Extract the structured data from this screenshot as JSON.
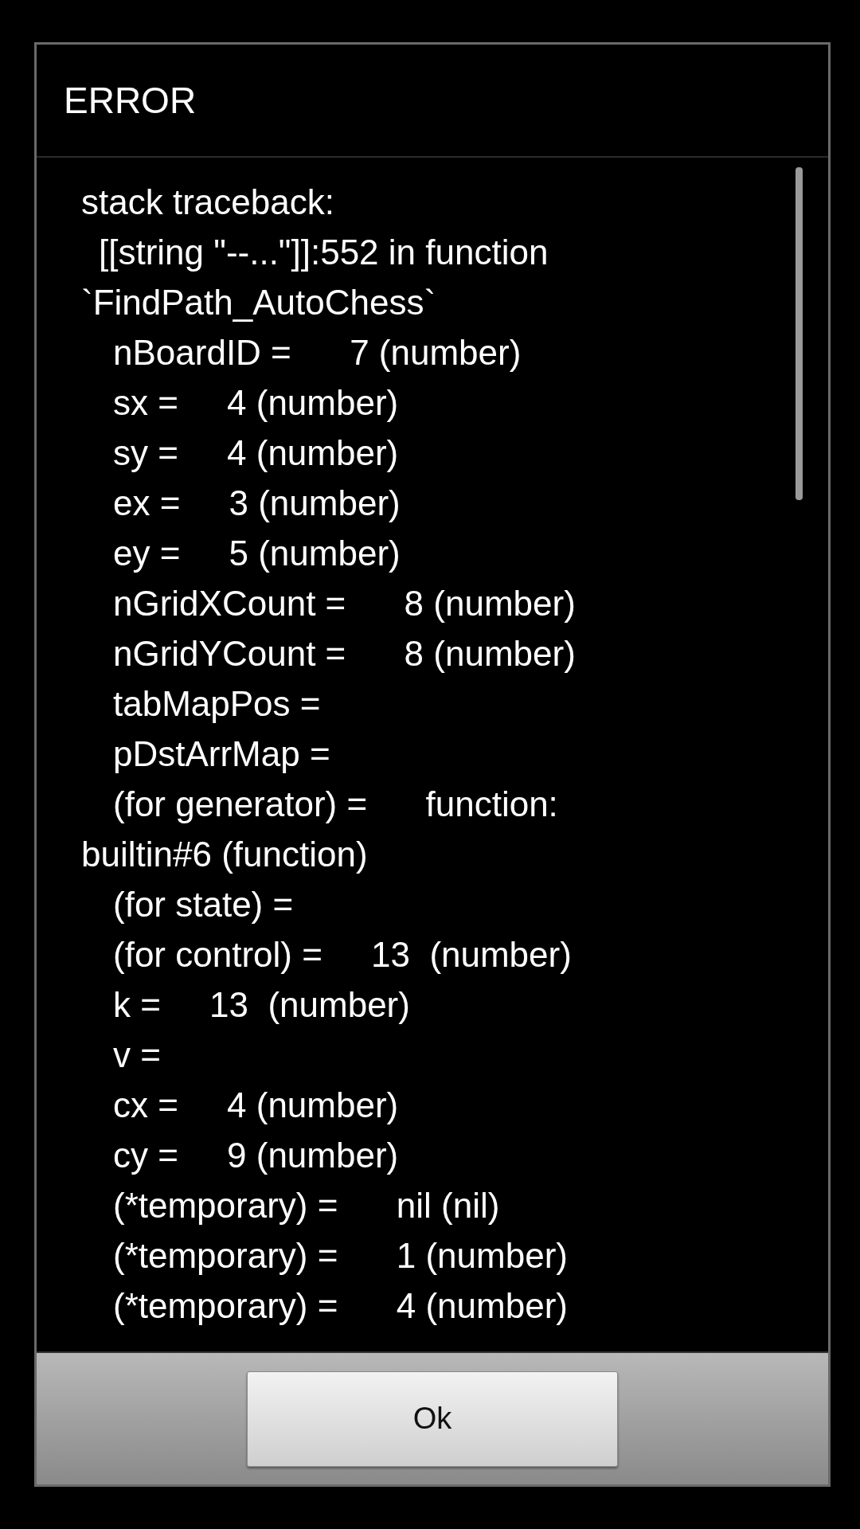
{
  "dialog": {
    "title": "ERROR",
    "lines": [
      {
        "kind": "flush",
        "text": "stack traceback:"
      },
      {
        "kind": "half",
        "text": "[[string \"--...\"]]:552 in function"
      },
      {
        "kind": "flush",
        "text": "`FindPath_AutoChess`"
      },
      {
        "kind": "indented",
        "text": "nBoardID =      7 (number)"
      },
      {
        "kind": "indented",
        "text": "sx =     4 (number)"
      },
      {
        "kind": "indented",
        "text": "sy =     4 (number)"
      },
      {
        "kind": "indented",
        "text": "ex =     3 (number)"
      },
      {
        "kind": "indented",
        "text": "ey =     5 (number)"
      },
      {
        "kind": "indented",
        "text": "nGridXCount =      8 (number)"
      },
      {
        "kind": "indented",
        "text": "nGridYCount =      8 (number)"
      },
      {
        "kind": "indented",
        "text": "tabMapPos ="
      },
      {
        "kind": "indented",
        "text": "pDstArrMap ="
      },
      {
        "kind": "indented",
        "text": "(for generator) =      function:"
      },
      {
        "kind": "flush",
        "text": "builtin#6 (function)"
      },
      {
        "kind": "indented",
        "text": "(for state) ="
      },
      {
        "kind": "indented",
        "text": "(for control) =     13  (number)"
      },
      {
        "kind": "indented",
        "text": "k =     13  (number)"
      },
      {
        "kind": "indented",
        "text": "v ="
      },
      {
        "kind": "indented",
        "text": "cx =     4 (number)"
      },
      {
        "kind": "indented",
        "text": "cy =     9 (number)"
      },
      {
        "kind": "indented",
        "text": "(*temporary) =      nil (nil)"
      },
      {
        "kind": "indented",
        "text": "(*temporary) =      1 (number)"
      },
      {
        "kind": "indented",
        "text": "(*temporary) =      4 (number)"
      }
    ],
    "button": "Ok"
  }
}
